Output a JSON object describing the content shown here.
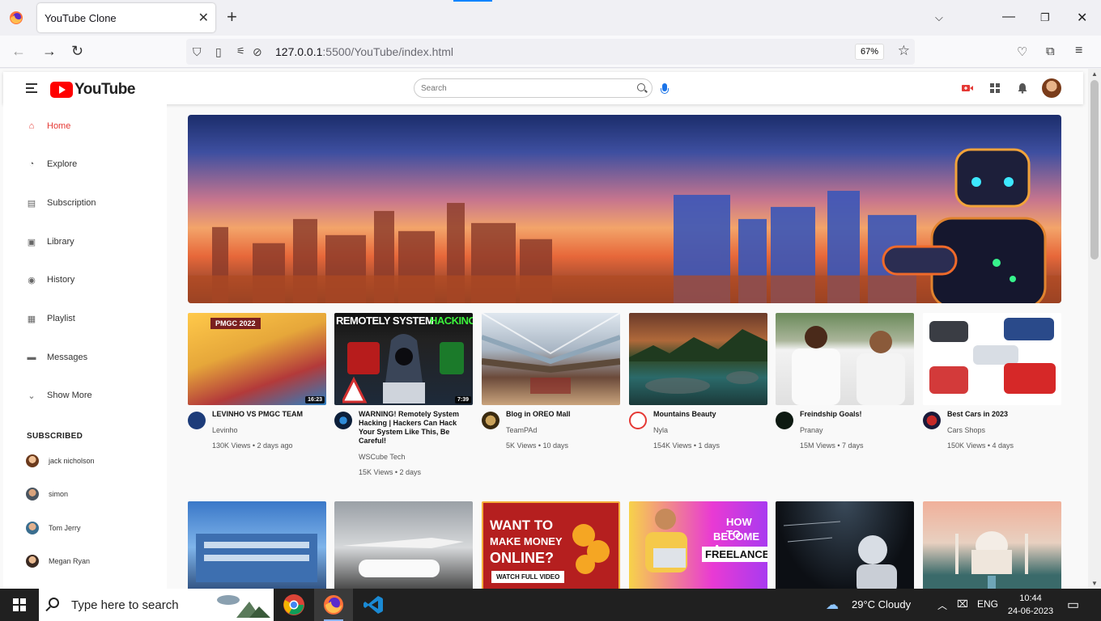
{
  "browser": {
    "tab_title": "YouTube Clone",
    "url_host": "127.0.0.1",
    "url_rest": ":5500/YouTube/index.html",
    "zoom": "67%"
  },
  "header": {
    "logo_text": "YouTube",
    "search_placeholder": "Search"
  },
  "sidebar": {
    "items": [
      {
        "label": "Home",
        "icon": "home-icon"
      },
      {
        "label": "Explore",
        "icon": "explore-icon"
      },
      {
        "label": "Subscription",
        "icon": "subscription-icon"
      },
      {
        "label": "Library",
        "icon": "library-icon"
      },
      {
        "label": "History",
        "icon": "history-icon"
      },
      {
        "label": "Playlist",
        "icon": "playlist-icon"
      },
      {
        "label": "Messages",
        "icon": "messages-icon"
      },
      {
        "label": "Show More",
        "icon": "chevron-down-icon"
      }
    ],
    "subscribed_title": "SUBSCRIBED",
    "subscribed": [
      {
        "name": "jack nicholson"
      },
      {
        "name": "simon"
      },
      {
        "name": "Tom Jerry"
      },
      {
        "name": "Megan Ryan"
      }
    ]
  },
  "videos": [
    {
      "title": "LEVINHO VS PMGC TEAM",
      "channel": "Levinho",
      "stats": "130K Views • 2 days ago",
      "duration": "16:23",
      "thumb_text": "PMGC 2022"
    },
    {
      "title": "WARNING! Remotely System Hacking | Hackers Can Hack Your System Like This, Be Careful!",
      "channel": "WSCube Tech",
      "stats": "15K Views • 2 days",
      "duration": "7:39",
      "thumb_text_a": "REMOTELY SYSTEM",
      "thumb_text_b": "HACKING"
    },
    {
      "title": "Blog in OREO Mall",
      "channel": "TeamPAd",
      "stats": "5K Views • 10 days"
    },
    {
      "title": "Mountains Beauty",
      "channel": "Nyla",
      "stats": "154K Views • 1 days"
    },
    {
      "title": "Freindship Goals!",
      "channel": "Pranay",
      "stats": "15M Views • 7 days"
    },
    {
      "title": "Best Cars in 2023",
      "channel": "Cars Shops",
      "stats": "150K Views • 4 days"
    }
  ],
  "row2_texts": {
    "money_a": "WANT TO",
    "money_b": "MAKE MONEY",
    "money_c": "ONLINE?",
    "money_btn": "WATCH FULL VIDEO",
    "freelancer_a": "HOW TO",
    "freelancer_b": "BECOME A",
    "freelancer_c": "FREELANCER"
  },
  "taskbar": {
    "search_placeholder": "Type here to search",
    "weather": "29°C  Cloudy",
    "lang": "ENG",
    "time": "10:44",
    "date": "24-06-2023"
  }
}
